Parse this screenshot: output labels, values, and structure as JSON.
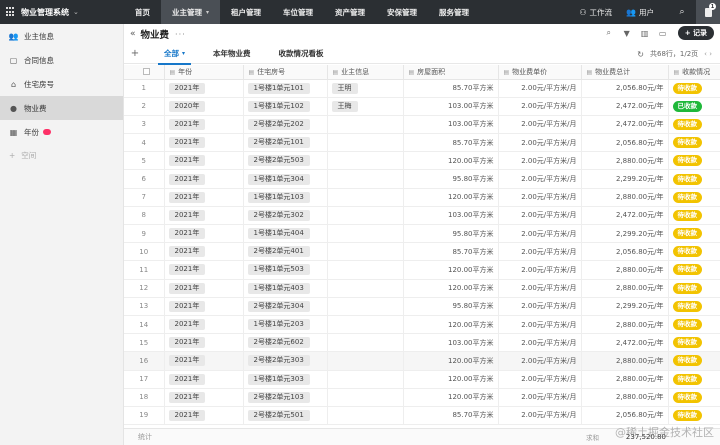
{
  "app": {
    "title": "物业管理系统",
    "nav": [
      {
        "label": "首页",
        "active": false,
        "dropdown": false
      },
      {
        "label": "业主管理",
        "active": true,
        "dropdown": true
      },
      {
        "label": "租户管理",
        "active": false,
        "dropdown": false
      },
      {
        "label": "车位管理",
        "active": false,
        "dropdown": false
      },
      {
        "label": "资产管理",
        "active": false,
        "dropdown": false
      },
      {
        "label": "安保管理",
        "active": false,
        "dropdown": false
      },
      {
        "label": "服务管理",
        "active": false,
        "dropdown": false
      }
    ],
    "right": {
      "workflow": "工作流",
      "user": "用户",
      "badge": "1"
    }
  },
  "sidebar": {
    "items": [
      {
        "label": "业主信息",
        "icon": "people-icon",
        "glyph": "👥",
        "active": false
      },
      {
        "label": "合同信息",
        "icon": "document-icon",
        "glyph": "▢",
        "active": false
      },
      {
        "label": "住宅房号",
        "icon": "home-icon",
        "glyph": "⌂",
        "active": false
      },
      {
        "label": "物业费",
        "icon": "coin-icon",
        "glyph": "●",
        "active": true
      },
      {
        "label": "年份",
        "icon": "calendar-icon",
        "glyph": "▦",
        "active": false
      }
    ],
    "add_label": "空间"
  },
  "main": {
    "title": "物业费",
    "record_button": "+ 记录",
    "tabs": [
      {
        "label": "全部",
        "active": true
      },
      {
        "label": "本年物业费",
        "active": false
      },
      {
        "label": "收款情况看板",
        "active": false
      }
    ],
    "summary": "共68行，1/2页",
    "columns": [
      "年份",
      "住宅房号",
      "业主信息",
      "房屋面积",
      "物业费单价",
      "物业费总计",
      "收款情况"
    ],
    "rows": [
      {
        "idx": "1",
        "year": "2021年",
        "room": "1号楼1单元101",
        "owner": "王明",
        "area": "85.70平方米",
        "price": "2.00元/平方米/月",
        "total": "2,056.80元/年",
        "status": "待收款"
      },
      {
        "idx": "2",
        "year": "2020年",
        "room": "1号楼1单元102",
        "owner": "王梅",
        "area": "103.00平方米",
        "price": "2.00元/平方米/月",
        "total": "2,472.00元/年",
        "status": "已收款"
      },
      {
        "idx": "3",
        "year": "2021年",
        "room": "2号楼2单元202",
        "owner": "",
        "area": "103.00平方米",
        "price": "2.00元/平方米/月",
        "total": "2,472.00元/年",
        "status": "待收款"
      },
      {
        "idx": "4",
        "year": "2021年",
        "room": "2号楼2单元101",
        "owner": "",
        "area": "85.70平方米",
        "price": "2.00元/平方米/月",
        "total": "2,056.80元/年",
        "status": "待收款"
      },
      {
        "idx": "5",
        "year": "2021年",
        "room": "2号楼2单元503",
        "owner": "",
        "area": "120.00平方米",
        "price": "2.00元/平方米/月",
        "total": "2,880.00元/年",
        "status": "待收款"
      },
      {
        "idx": "6",
        "year": "2021年",
        "room": "1号楼1单元304",
        "owner": "",
        "area": "95.80平方米",
        "price": "2.00元/平方米/月",
        "total": "2,299.20元/年",
        "status": "待收款"
      },
      {
        "idx": "7",
        "year": "2021年",
        "room": "1号楼1单元103",
        "owner": "",
        "area": "120.00平方米",
        "price": "2.00元/平方米/月",
        "total": "2,880.00元/年",
        "status": "待收款"
      },
      {
        "idx": "8",
        "year": "2021年",
        "room": "2号楼2单元302",
        "owner": "",
        "area": "103.00平方米",
        "price": "2.00元/平方米/月",
        "total": "2,472.00元/年",
        "status": "待收款"
      },
      {
        "idx": "9",
        "year": "2021年",
        "room": "1号楼1单元404",
        "owner": "",
        "area": "95.80平方米",
        "price": "2.00元/平方米/月",
        "total": "2,299.20元/年",
        "status": "待收款"
      },
      {
        "idx": "10",
        "year": "2021年",
        "room": "2号楼2单元401",
        "owner": "",
        "area": "85.70平方米",
        "price": "2.00元/平方米/月",
        "total": "2,056.80元/年",
        "status": "待收款"
      },
      {
        "idx": "11",
        "year": "2021年",
        "room": "1号楼1单元503",
        "owner": "",
        "area": "120.00平方米",
        "price": "2.00元/平方米/月",
        "total": "2,880.00元/年",
        "status": "待收款"
      },
      {
        "idx": "12",
        "year": "2021年",
        "room": "1号楼1单元403",
        "owner": "",
        "area": "120.00平方米",
        "price": "2.00元/平方米/月",
        "total": "2,880.00元/年",
        "status": "待收款"
      },
      {
        "idx": "13",
        "year": "2021年",
        "room": "2号楼2单元304",
        "owner": "",
        "area": "95.80平方米",
        "price": "2.00元/平方米/月",
        "total": "2,299.20元/年",
        "status": "待收款"
      },
      {
        "idx": "14",
        "year": "2021年",
        "room": "1号楼1单元203",
        "owner": "",
        "area": "120.00平方米",
        "price": "2.00元/平方米/月",
        "total": "2,880.00元/年",
        "status": "待收款"
      },
      {
        "idx": "15",
        "year": "2021年",
        "room": "2号楼2单元602",
        "owner": "",
        "area": "103.00平方米",
        "price": "2.00元/平方米/月",
        "total": "2,472.00元/年",
        "status": "待收款"
      },
      {
        "idx": "16",
        "year": "2021年",
        "room": "2号楼2单元303",
        "owner": "",
        "area": "120.00平方米",
        "price": "2.00元/平方米/月",
        "total": "2,880.00元/年",
        "status": "待收款"
      },
      {
        "idx": "17",
        "year": "2021年",
        "room": "1号楼1单元303",
        "owner": "",
        "area": "120.00平方米",
        "price": "2.00元/平方米/月",
        "total": "2,880.00元/年",
        "status": "待收款"
      },
      {
        "idx": "18",
        "year": "2021年",
        "room": "2号楼2单元103",
        "owner": "",
        "area": "120.00平方米",
        "price": "2.00元/平方米/月",
        "total": "2,880.00元/年",
        "status": "待收款"
      },
      {
        "idx": "19",
        "year": "2021年",
        "room": "2号楼2单元501",
        "owner": "",
        "area": "85.70平方米",
        "price": "2.00元/平方米/月",
        "total": "2,056.80元/年",
        "status": "待收款"
      }
    ],
    "footer": {
      "label": "统计",
      "sum_label": "求和",
      "sum_value": "237,520.80"
    },
    "watermark": "@稀土掘金技术社区"
  },
  "colors": {
    "topbar": "#2b2f33",
    "accent": "#1677c9",
    "status_pending": "#f2c300",
    "status_paid": "#1fb83a"
  }
}
